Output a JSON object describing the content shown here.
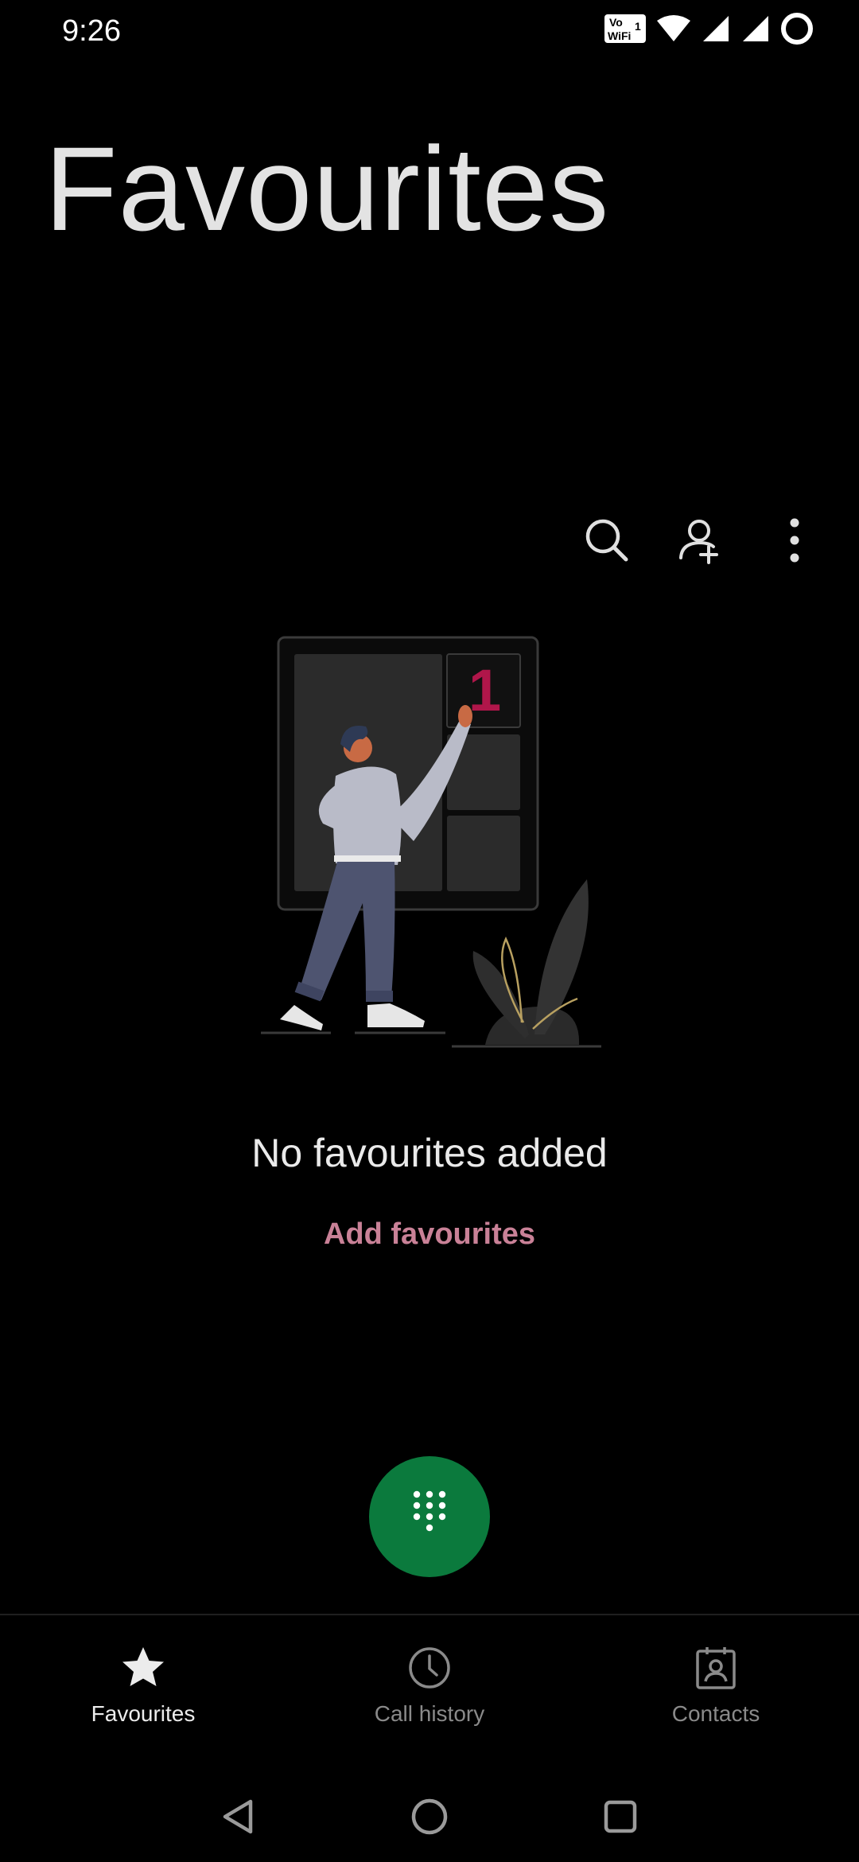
{
  "status_bar": {
    "time": "9:26",
    "icons": [
      "volte-wifi-icon",
      "wifi-icon",
      "signal-icon",
      "signal-icon",
      "circle-status-icon"
    ]
  },
  "page": {
    "title": "Favourites"
  },
  "toolbar": {
    "icons": [
      "search-icon",
      "add-contact-icon",
      "more-vert-icon"
    ]
  },
  "empty_state": {
    "illustration_number": "1",
    "message": "No favourites added",
    "action_label": "Add favourites"
  },
  "fab": {
    "icon": "dialpad-icon",
    "color": "#0b7a3d"
  },
  "bottom_nav": {
    "items": [
      {
        "label": "Favourites",
        "icon": "star-icon",
        "active": true
      },
      {
        "label": "Call history",
        "icon": "clock-icon",
        "active": false
      },
      {
        "label": "Contacts",
        "icon": "contacts-icon",
        "active": false
      }
    ]
  },
  "system_nav": {
    "icons": [
      "back-icon",
      "home-icon",
      "recents-icon"
    ]
  },
  "colors": {
    "background": "#000000",
    "accent_link": "#c98197",
    "fab": "#0b7a3d",
    "illustration_number": "#b0164a"
  }
}
